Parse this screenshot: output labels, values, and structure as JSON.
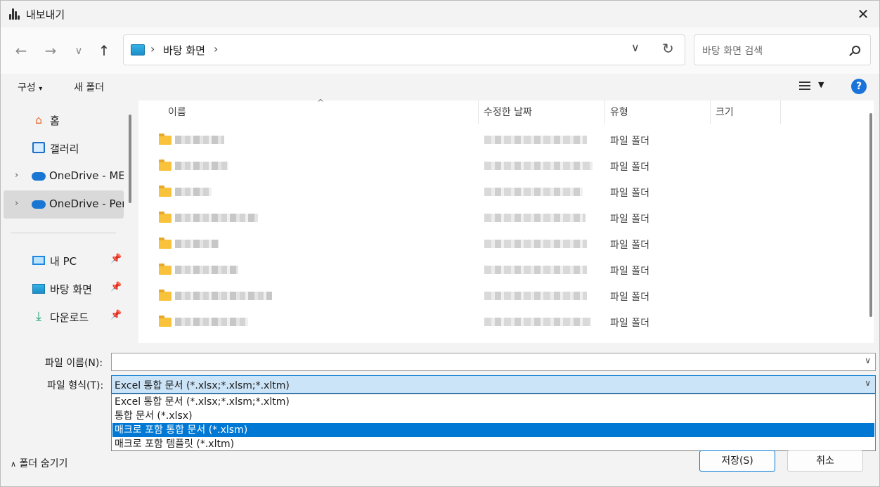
{
  "window": {
    "title": "내보내기",
    "app_icon": "audio-waveform-icon"
  },
  "nav": {
    "breadcrumb": "바탕 화면",
    "search_placeholder": "바탕 화면 검색"
  },
  "toolbar": {
    "organize": "구성",
    "new_folder": "새 폴더",
    "help": "?"
  },
  "sidebar": {
    "items": [
      {
        "label": "홈",
        "icon": "home-icon"
      },
      {
        "label": "갤러리",
        "icon": "gallery-icon"
      },
      {
        "label": "OneDrive - MES",
        "icon": "cloud-icon"
      },
      {
        "label": "OneDrive - Pers",
        "icon": "cloud-icon"
      },
      {
        "label": "내 PC",
        "icon": "pc-icon"
      },
      {
        "label": "바탕 화면",
        "icon": "desktop-icon"
      },
      {
        "label": "다운로드",
        "icon": "download-icon"
      }
    ]
  },
  "columns": {
    "name": "이름",
    "date": "수정한 날짜",
    "type": "유형",
    "size": "크기"
  },
  "rows": [
    {
      "type": "파일 폴더"
    },
    {
      "type": "파일 폴더"
    },
    {
      "type": "파일 폴더"
    },
    {
      "type": "파일 폴더"
    },
    {
      "type": "파일 폴더"
    },
    {
      "type": "파일 폴더"
    },
    {
      "type": "파일 폴더"
    },
    {
      "type": "파일 폴더"
    }
  ],
  "form": {
    "filename_label": "파일 이름(N):",
    "filename_value": "",
    "filetype_label": "파일 형식(T):",
    "filetype_value": "Excel 통합 문서 (*.xlsx;*.xlsm;*.xltm)",
    "options": [
      "Excel 통합 문서 (*.xlsx;*.xlsm;*.xltm)",
      "통합 문서 (*.xlsx)",
      "매크로 포함 통합 문서 (*.xlsm)",
      "매크로 포함 템플릿 (*.xltm)"
    ],
    "selected_option_index": 2
  },
  "footer": {
    "hide_folders": "폴더 숨기기",
    "save": "저장(S)",
    "cancel": "취소"
  },
  "colors": {
    "accent": "#0078d4",
    "folder": "#f8c33b"
  }
}
